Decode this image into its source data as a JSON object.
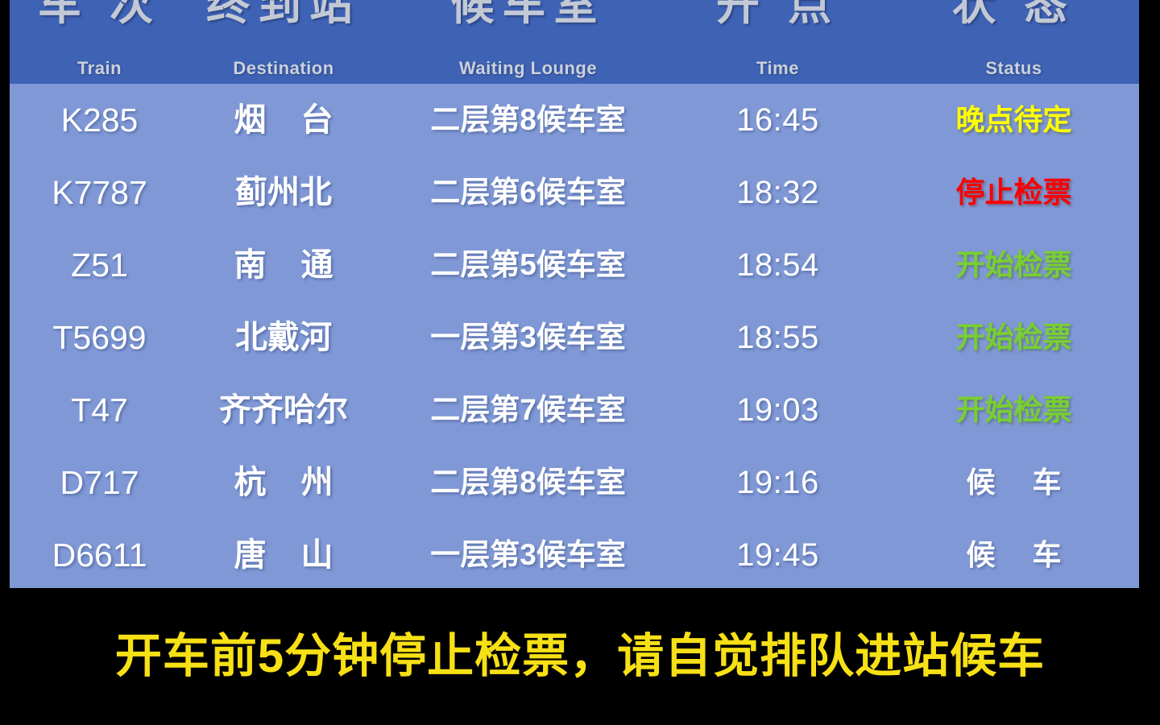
{
  "board": {
    "background_color": "#8099d6",
    "header_background_color": "#3e62b4",
    "notice_background_color": "#000000"
  },
  "header": {
    "columns": [
      {
        "cn": "车 次",
        "en": "Train"
      },
      {
        "cn": "终到站",
        "en": "Destination"
      },
      {
        "cn": "候车室",
        "en": "Waiting Lounge"
      },
      {
        "cn": "开 点",
        "en": "Time"
      },
      {
        "cn": "状 态",
        "en": "Status"
      }
    ]
  },
  "rows": [
    {
      "train": "K285",
      "destination": "烟 台",
      "lounge": "二层第8候车室",
      "time": "16:45",
      "status": "晚点待定",
      "status_color": "#ffff00"
    },
    {
      "train": "K7787",
      "destination": "蓟州北",
      "lounge": "二层第6候车室",
      "time": "18:32",
      "status": "停止检票",
      "status_color": "#fb0000"
    },
    {
      "train": "Z51",
      "destination": "南 通",
      "lounge": "二层第5候车室",
      "time": "18:54",
      "status": "开始检票",
      "status_color": "#7ace32"
    },
    {
      "train": "T5699",
      "destination": "北戴河",
      "lounge": "一层第3候车室",
      "time": "18:55",
      "status": "开始检票",
      "status_color": "#7ace32"
    },
    {
      "train": "T47",
      "destination": "齐齐哈尔",
      "lounge": "二层第7候车室",
      "time": "19:03",
      "status": "开始检票",
      "status_color": "#7ace32"
    },
    {
      "train": "D717",
      "destination": "杭 州",
      "lounge": "二层第8候车室",
      "time": "19:16",
      "status": "候 车",
      "status_color": "#ffffff"
    },
    {
      "train": "D6611",
      "destination": "唐 山",
      "lounge": "一层第3候车室",
      "time": "19:45",
      "status": "候 车",
      "status_color": "#ffffff"
    }
  ],
  "notice": {
    "text": "开车前5分钟停止检票，请自觉排队进站候车",
    "color": "#f7e015"
  }
}
